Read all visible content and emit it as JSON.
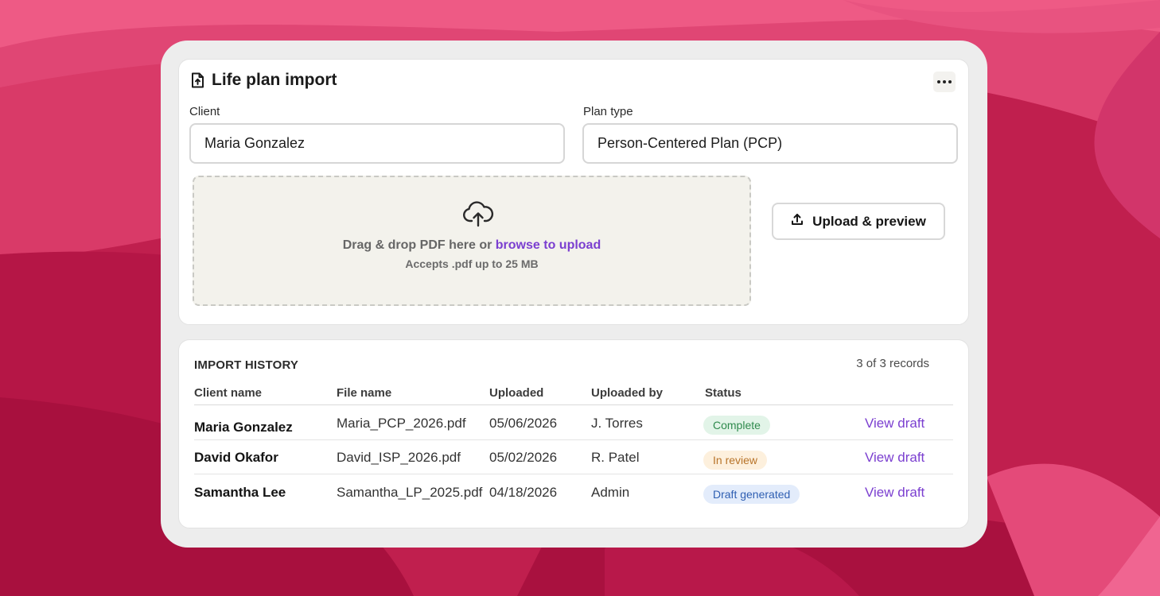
{
  "page": {
    "title": "Life plan import"
  },
  "form": {
    "client_label": "Client",
    "client_value": "Maria Gonzalez",
    "plan_type_label": "Plan type",
    "plan_type_value": "Person-Centered Plan (PCP)"
  },
  "dropzone": {
    "text": "Drag & drop PDF here or ",
    "link": "browse to upload",
    "subtext": "Accepts .pdf up to 25 MB"
  },
  "upload_button": {
    "label": "Upload & preview"
  },
  "history": {
    "title": "IMPORT HISTORY",
    "records": "3 of 3 records",
    "columns": [
      "Client name",
      "File name",
      "Uploaded",
      "Uploaded by",
      "Status"
    ],
    "rows": [
      {
        "client": "Maria Gonzalez",
        "file": "Maria_PCP_2026.pdf",
        "uploaded": "05/06/2026",
        "by": "J. Torres",
        "status": "Complete",
        "action": "View draft"
      },
      {
        "client": "David Okafor",
        "file": "David_ISP_2026.pdf",
        "uploaded": "05/02/2026",
        "by": "R. Patel",
        "status": "In review",
        "action": "View draft"
      },
      {
        "client": "Samantha Lee",
        "file": "Samantha_LP_2025.pdf",
        "uploaded": "04/18/2026",
        "by": "Admin",
        "status": "Draft generated",
        "action": "View draft"
      }
    ]
  },
  "colors": {
    "background": "#c2214f",
    "accent": "#7b3fd0",
    "status_complete": "#2f8a4d",
    "status_review": "#b8742a",
    "status_draft": "#2f5fb2"
  },
  "icons": {
    "title": "file-upload-icon",
    "menu": "more-horizontal-icon",
    "dropzone": "cloud-upload-icon",
    "button": "upload-icon"
  }
}
